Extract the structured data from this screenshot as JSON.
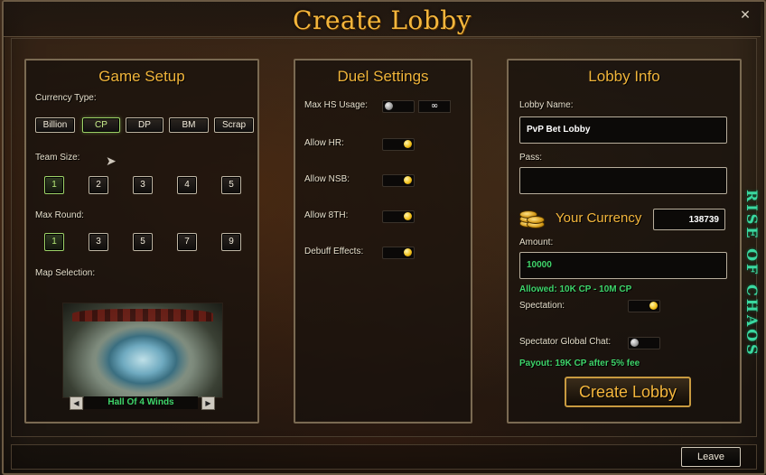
{
  "window": {
    "title": "Create Lobby",
    "close_glyph": "✕",
    "leave_label": "Leave"
  },
  "side_banner": "RISE OF CHAOS",
  "game_setup": {
    "title": "Game Setup",
    "currency_label": "Currency Type:",
    "currency_options": [
      "Billion",
      "CP",
      "DP",
      "BM",
      "Scrap"
    ],
    "currency_selected": "CP",
    "team_size_label": "Team Size:",
    "team_sizes": [
      "1",
      "2",
      "3",
      "4",
      "5"
    ],
    "team_size_selected": "1",
    "max_round_label": "Max Round:",
    "max_rounds": [
      "1",
      "3",
      "5",
      "7",
      "9"
    ],
    "max_round_selected": "1",
    "map_label": "Map Selection:",
    "map_name": "Hall Of 4 Winds",
    "prev_glyph": "◀",
    "next_glyph": "▶"
  },
  "duel_settings": {
    "title": "Duel Settings",
    "max_hs_label": "Max HS Usage:",
    "max_hs_value": "∞",
    "max_hs_enabled": false,
    "allow_hr_label": "Allow HR:",
    "allow_hr": true,
    "allow_nsb_label": "Allow NSB:",
    "allow_nsb": true,
    "allow_8th_label": "Allow 8TH:",
    "allow_8th": true,
    "debuff_label": "Debuff Effects:",
    "debuff": true
  },
  "lobby_info": {
    "title": "Lobby Info",
    "name_label": "Lobby Name:",
    "name_value": "PvP Bet Lobby",
    "pass_label": "Pass:",
    "pass_value": "",
    "currency_heading": "Your Currency",
    "currency_amount": "138739",
    "amount_label": "Amount:",
    "amount_value": "10000",
    "allowed_text": "Allowed: 10K CP - 10M CP",
    "spectation_label": "Spectation:",
    "spectation": true,
    "spectator_chat_label": "Spectator Global Chat:",
    "spectator_chat": false,
    "payout_text": "Payout: 19K CP after 5% fee",
    "create_label": "Create Lobby"
  },
  "colors": {
    "accent": "#f4b63c",
    "selected": "#9ed468",
    "info_green": "#3ad8a0"
  }
}
